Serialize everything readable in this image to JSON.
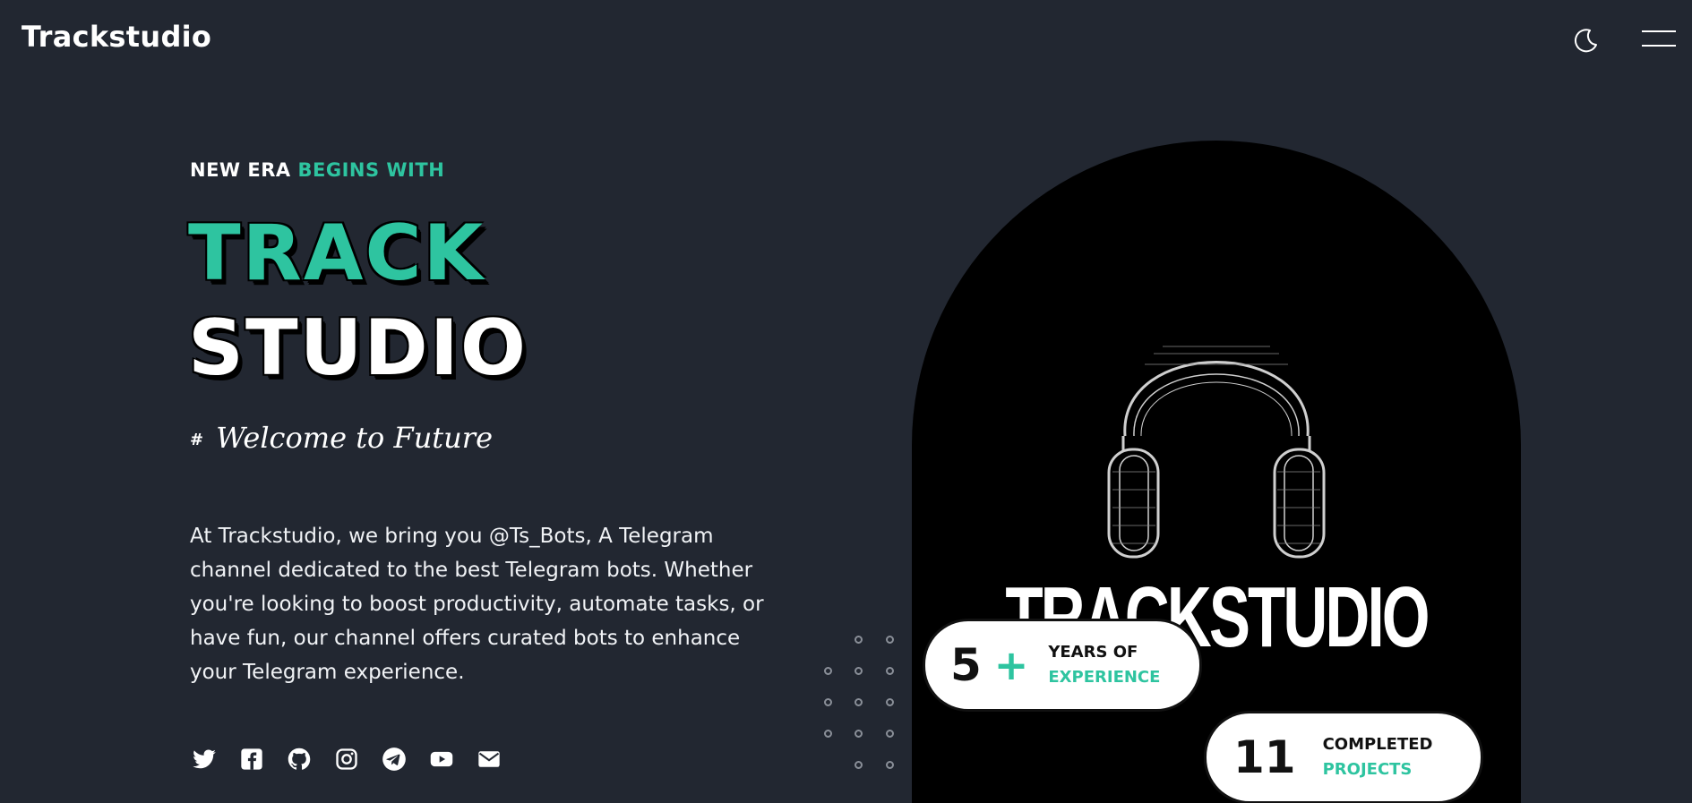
{
  "header": {
    "brand": "Trackstudio",
    "theme_icon": "moon-icon",
    "menu_icon": "hamburger-menu-icon"
  },
  "hero": {
    "tagline_white": "NEW ERA",
    "tagline_accent": "BEGINS WITH",
    "title_line1": "TRACK",
    "title_line2": "STUDIO",
    "welcome_hash": "#",
    "welcome_text": "Welcome to Future",
    "description": "At Trackstudio, we bring you @Ts_Bots, A Telegram channel dedicated to the best Telegram bots. Whether you're looking to boost productivity, automate tasks, or have fun, our channel offers curated bots to enhance your Telegram experience."
  },
  "social_icons": [
    "twitter-icon",
    "facebook-icon",
    "github-icon",
    "instagram-icon",
    "telegram-icon",
    "youtube-icon",
    "email-icon"
  ],
  "hero_image": {
    "wordmark": "TRACKSTUDIO"
  },
  "stats": {
    "years": {
      "number": "5",
      "plus": "+",
      "label_line1": "YEARS OF",
      "label_line2": "EXPERIENCE"
    },
    "projects": {
      "number": "11",
      "label_line1": "COMPLETED",
      "label_line2": "PROJECTS"
    }
  },
  "colors": {
    "background": "#222731",
    "accent": "#2ec4a0",
    "text": "#ffffff"
  }
}
